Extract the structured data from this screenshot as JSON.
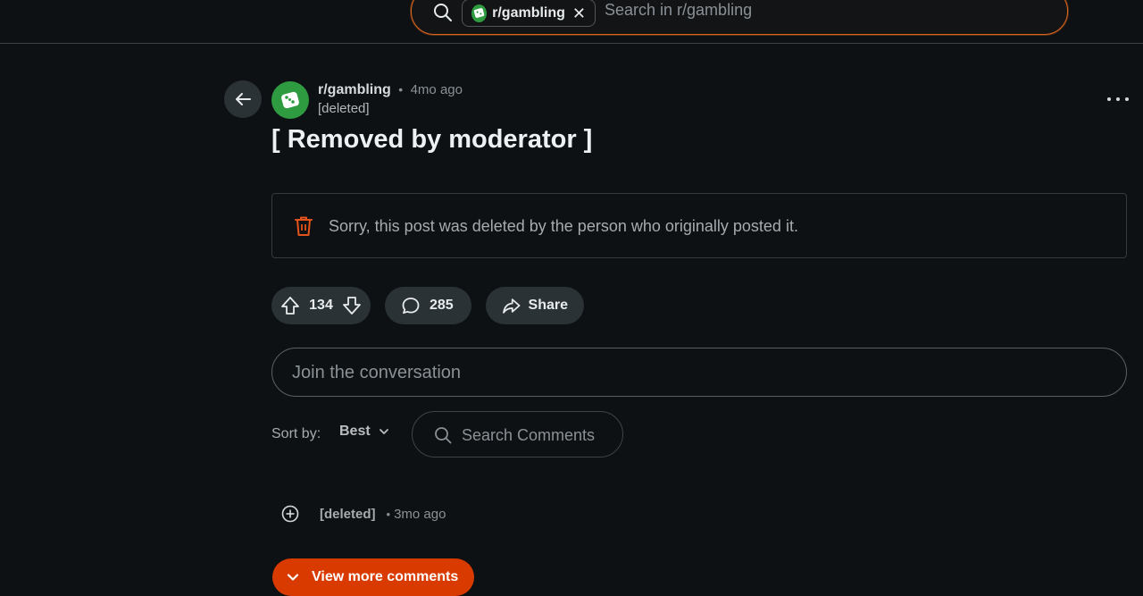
{
  "search": {
    "chip_label": "r/gambling",
    "chip_close": "✕",
    "placeholder": "Search in r/gambling"
  },
  "post": {
    "subreddit": "r/gambling",
    "separator": "•",
    "age": "4mo ago",
    "author": "[deleted]",
    "title": "[ Removed by moderator ]",
    "notice": "Sorry, this post was deleted by the person who originally posted it."
  },
  "actions": {
    "votes": "134",
    "comments": "285",
    "share_label": "Share"
  },
  "comment_box": {
    "placeholder": "Join the conversation"
  },
  "sort": {
    "label": "Sort by:",
    "value": "Best",
    "search_placeholder": "Search Comments"
  },
  "comments": [
    {
      "author": "[deleted]",
      "separator": "•",
      "age": "3mo ago"
    }
  ],
  "view_more_label": "View more comments",
  "colors": {
    "background": "#0e1113",
    "accent": "#d93a00",
    "search_border": "#d9661e",
    "subreddit_avatar": "#2f9b41"
  }
}
